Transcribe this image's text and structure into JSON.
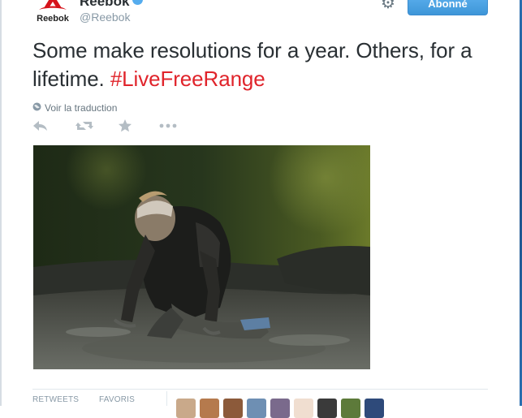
{
  "author": {
    "name": "Reebok",
    "handle": "@Reebok",
    "logo_text": "Reebok"
  },
  "header": {
    "follow_label": "Abonné"
  },
  "tweet": {
    "text": "Some make resolutions for a year. Others, for a lifetime. ",
    "hashtag": "#LiveFreeRange",
    "translate_label": "Voir la traduction"
  },
  "actions": {
    "reply_icon": "reply-icon",
    "retweet_icon": "retweet-icon",
    "favorite_icon": "star-icon",
    "more_icon": "more-icon"
  },
  "stats": {
    "retweets_label": "RETWEETS",
    "favorites_label": "FAVORIS"
  },
  "colors": {
    "accent": "#55acee",
    "hashtag": "#e0242b",
    "brand_red": "#d6131b"
  }
}
